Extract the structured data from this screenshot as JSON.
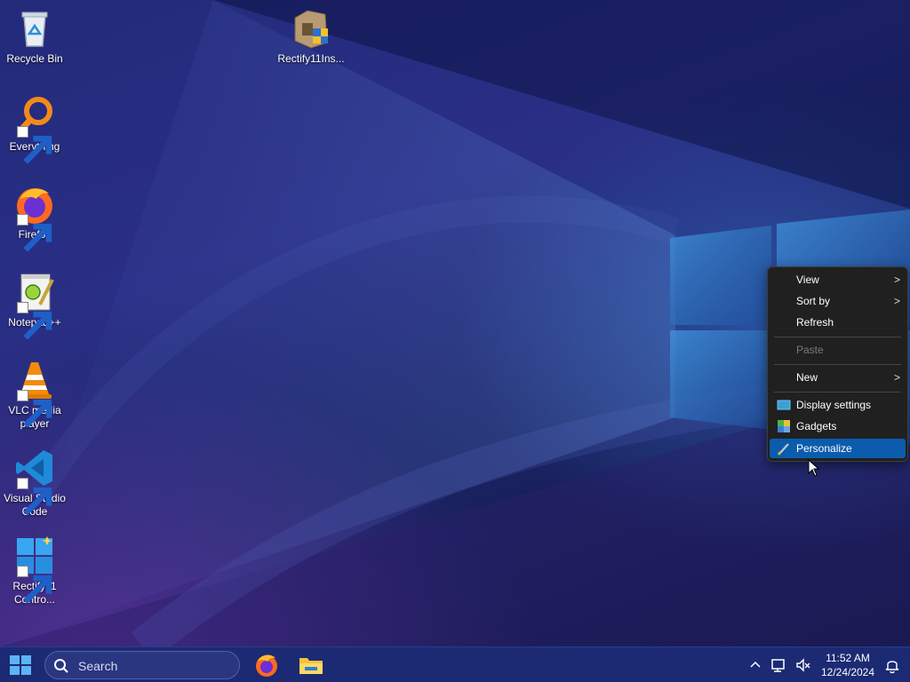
{
  "desktop": {
    "icons": [
      {
        "label": "Recycle Bin"
      },
      {
        "label": "Rectify11Ins..."
      },
      {
        "label": "Everything"
      },
      {
        "label": "Firefox"
      },
      {
        "label": "Notepad++"
      },
      {
        "label": "VLC media player"
      },
      {
        "label": "Visual Studio Code"
      },
      {
        "label": "Rectify11 Contro..."
      }
    ]
  },
  "context_menu": {
    "items": [
      {
        "label": "View",
        "has_submenu": true
      },
      {
        "label": "Sort by",
        "has_submenu": true
      },
      {
        "label": "Refresh"
      },
      {
        "label": "Paste",
        "disabled": true
      },
      {
        "label": "New",
        "has_submenu": true
      },
      {
        "label": "Display settings",
        "icon": "display-icon"
      },
      {
        "label": "Gadgets",
        "icon": "gadgets-icon"
      },
      {
        "label": "Personalize",
        "icon": "brush-icon",
        "highlighted": true
      }
    ],
    "chevron": ">"
  },
  "taskbar": {
    "search_placeholder": "Search",
    "pinned": [
      {
        "name": "Firefox",
        "icon": "firefox-icon"
      },
      {
        "name": "File Explorer",
        "icon": "folder-icon"
      }
    ],
    "tray": {
      "overflow_icon": "chevron-up-icon",
      "network_icon": "network-icon",
      "volume_icon": "volume-muted-icon",
      "notification_icon": "bell-icon"
    },
    "clock": {
      "time": "11:52 AM",
      "date": "12/24/2024"
    }
  },
  "colors": {
    "accent": "#0b5cad",
    "menu_bg": "#202020",
    "taskbar_bg": "#1b2a73"
  }
}
